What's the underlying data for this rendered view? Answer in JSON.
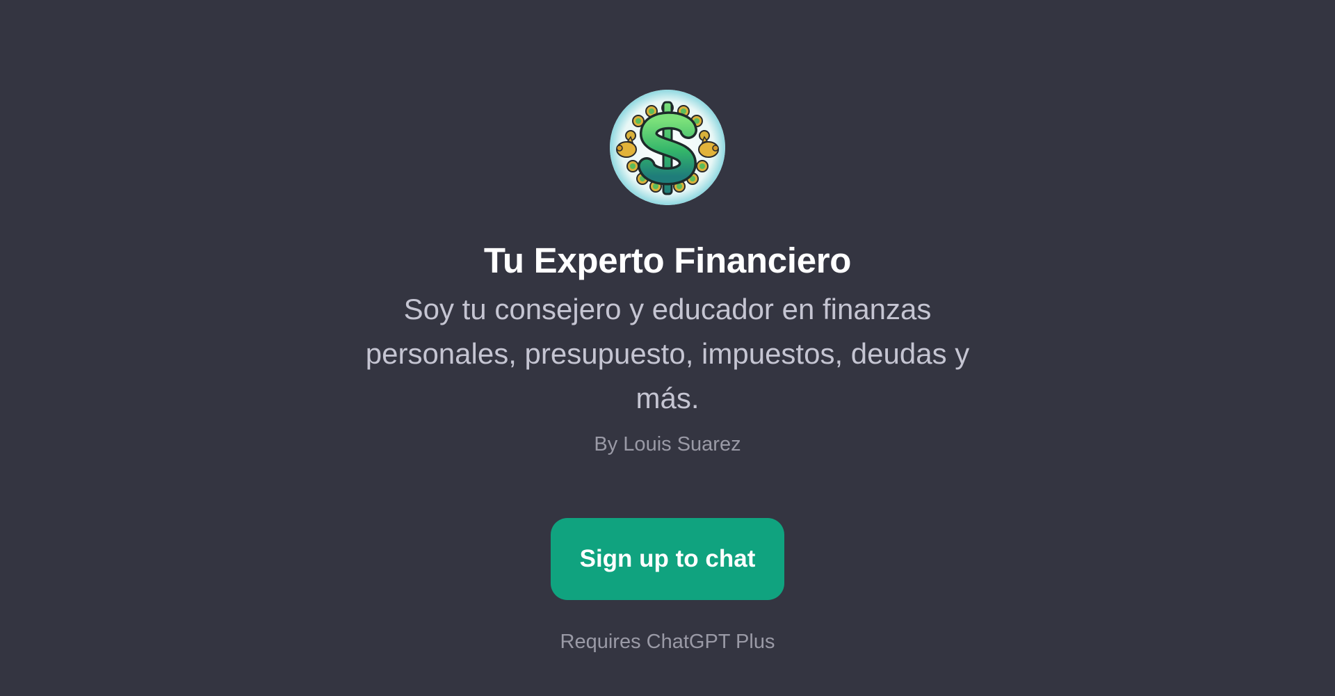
{
  "gpt": {
    "name": "Tu Experto Financiero",
    "description": "Soy tu consejero y educador en finanzas personales, presupuesto, impuestos, deudas y más.",
    "author": "By Louis Suarez"
  },
  "avatar": {
    "icon": "dollar-coin-wreath-logo"
  },
  "actions": {
    "signup_label": "Sign up to chat",
    "requires_text": "Requires ChatGPT Plus"
  },
  "colors": {
    "background": "#343541",
    "accent": "#10a37f",
    "title": "#ffffff",
    "description": "#c5c5d2",
    "muted": "#9a9aa6"
  }
}
